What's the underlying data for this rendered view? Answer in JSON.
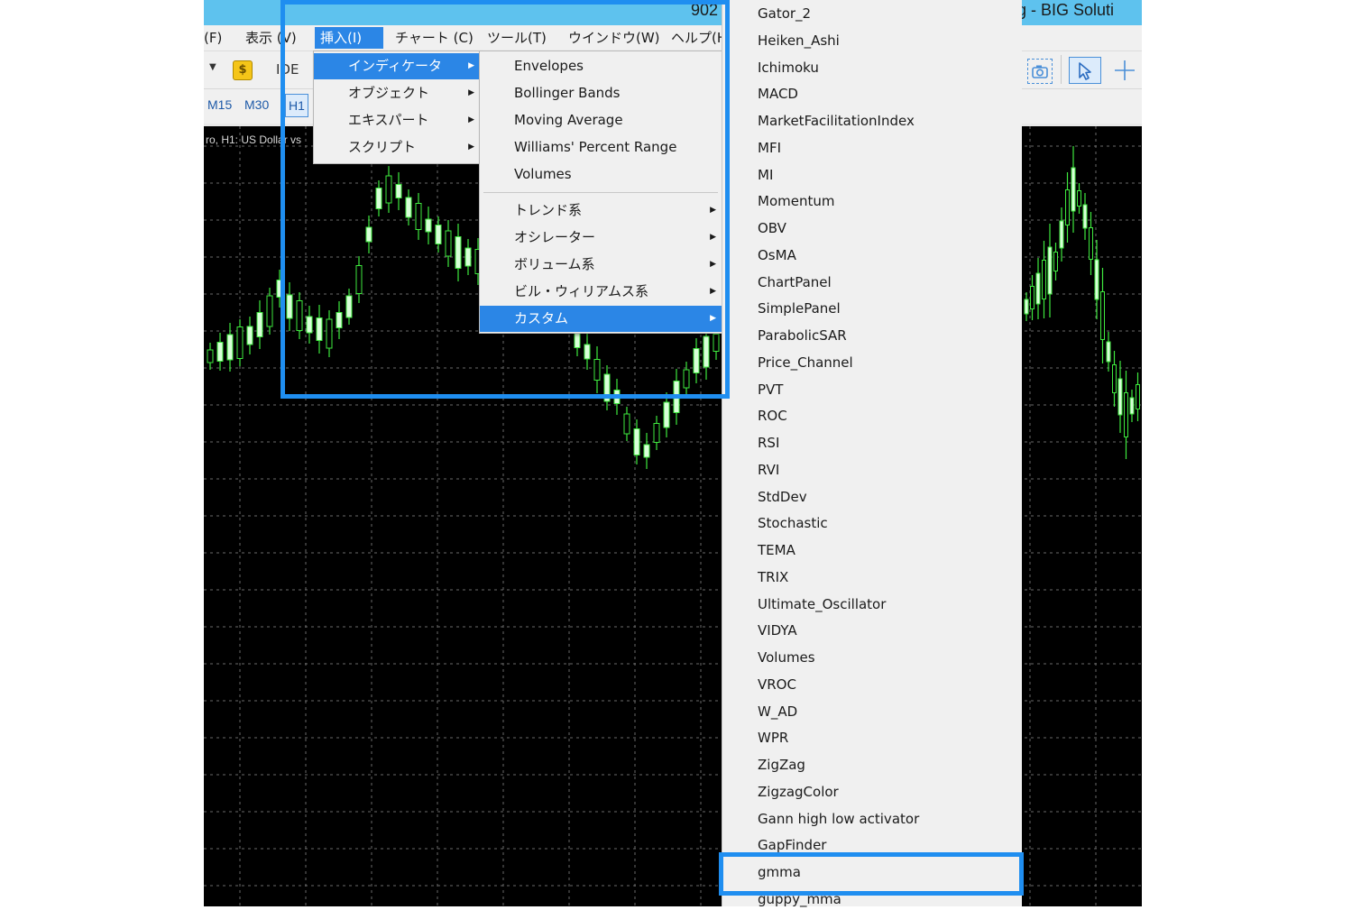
{
  "window": {
    "title_number": "902",
    "title_suffix": "g - BIG Soluti"
  },
  "menubar": {
    "file": "(F)",
    "view": "表示 (V)",
    "insert": "挿入(I)",
    "chart": "チャート (C)",
    "tools": "ツール(T)",
    "window": "ウインドウ(W)",
    "help": "ヘルプ(H"
  },
  "toolbar": {
    "dollar_icon": "dollar-icon",
    "ide_label": "IDE",
    "screenshot_icon": "camera-icon",
    "cursor_icon": "cursor-icon",
    "crosshair_icon": "crosshair-icon"
  },
  "timeframes": [
    "M15",
    "M30",
    "H1"
  ],
  "chart": {
    "label": "ro, H1: US Dollar vs"
  },
  "insert_menu": [
    {
      "label": "インディケータ",
      "submenu": true,
      "highlighted": true
    },
    {
      "label": "オブジェクト",
      "submenu": true
    },
    {
      "label": "エキスパート",
      "submenu": true
    },
    {
      "label": "スクリプト",
      "submenu": true
    }
  ],
  "indicator_menu": {
    "items": [
      {
        "label": "Envelopes"
      },
      {
        "label": "Bollinger Bands"
      },
      {
        "label": "Moving Average"
      },
      {
        "label": "Williams' Percent Range"
      },
      {
        "label": "Volumes"
      }
    ],
    "groups": [
      {
        "label": "トレンド系",
        "submenu": true
      },
      {
        "label": "オシレーター",
        "submenu": true
      },
      {
        "label": "ボリューム系",
        "submenu": true
      },
      {
        "label": "ビル・ウィリアムス系",
        "submenu": true
      },
      {
        "label": "カスタム",
        "submenu": true,
        "highlighted": true
      }
    ]
  },
  "custom_menu": {
    "items": [
      "Gator_2",
      "Heiken_Ashi",
      "Ichimoku",
      "MACD",
      "MarketFacilitationIndex",
      "MFI",
      "MI",
      "Momentum",
      "OBV",
      "OsMA",
      "ChartPanel",
      "SimplePanel",
      "ParabolicSAR",
      "Price_Channel",
      "PVT",
      "ROC",
      "RSI",
      "RVI",
      "StdDev",
      "Stochastic",
      "TEMA",
      "TRIX",
      "Ultimate_Oscillator",
      "VIDYA",
      "Volumes",
      "VROC",
      "W_AD",
      "WPR",
      "ZigZag",
      "ZigzagColor",
      "Gann high low activator",
      "GapFinder",
      "gmma",
      "guppy_mma"
    ],
    "selected": "gmma"
  },
  "colors": {
    "title_bar": "#5ec2ee",
    "menu_highlight": "#2b86e6",
    "callout_border": "#1f8ef0",
    "chart_background": "#000000",
    "candle_color": "#3ee83e"
  }
}
